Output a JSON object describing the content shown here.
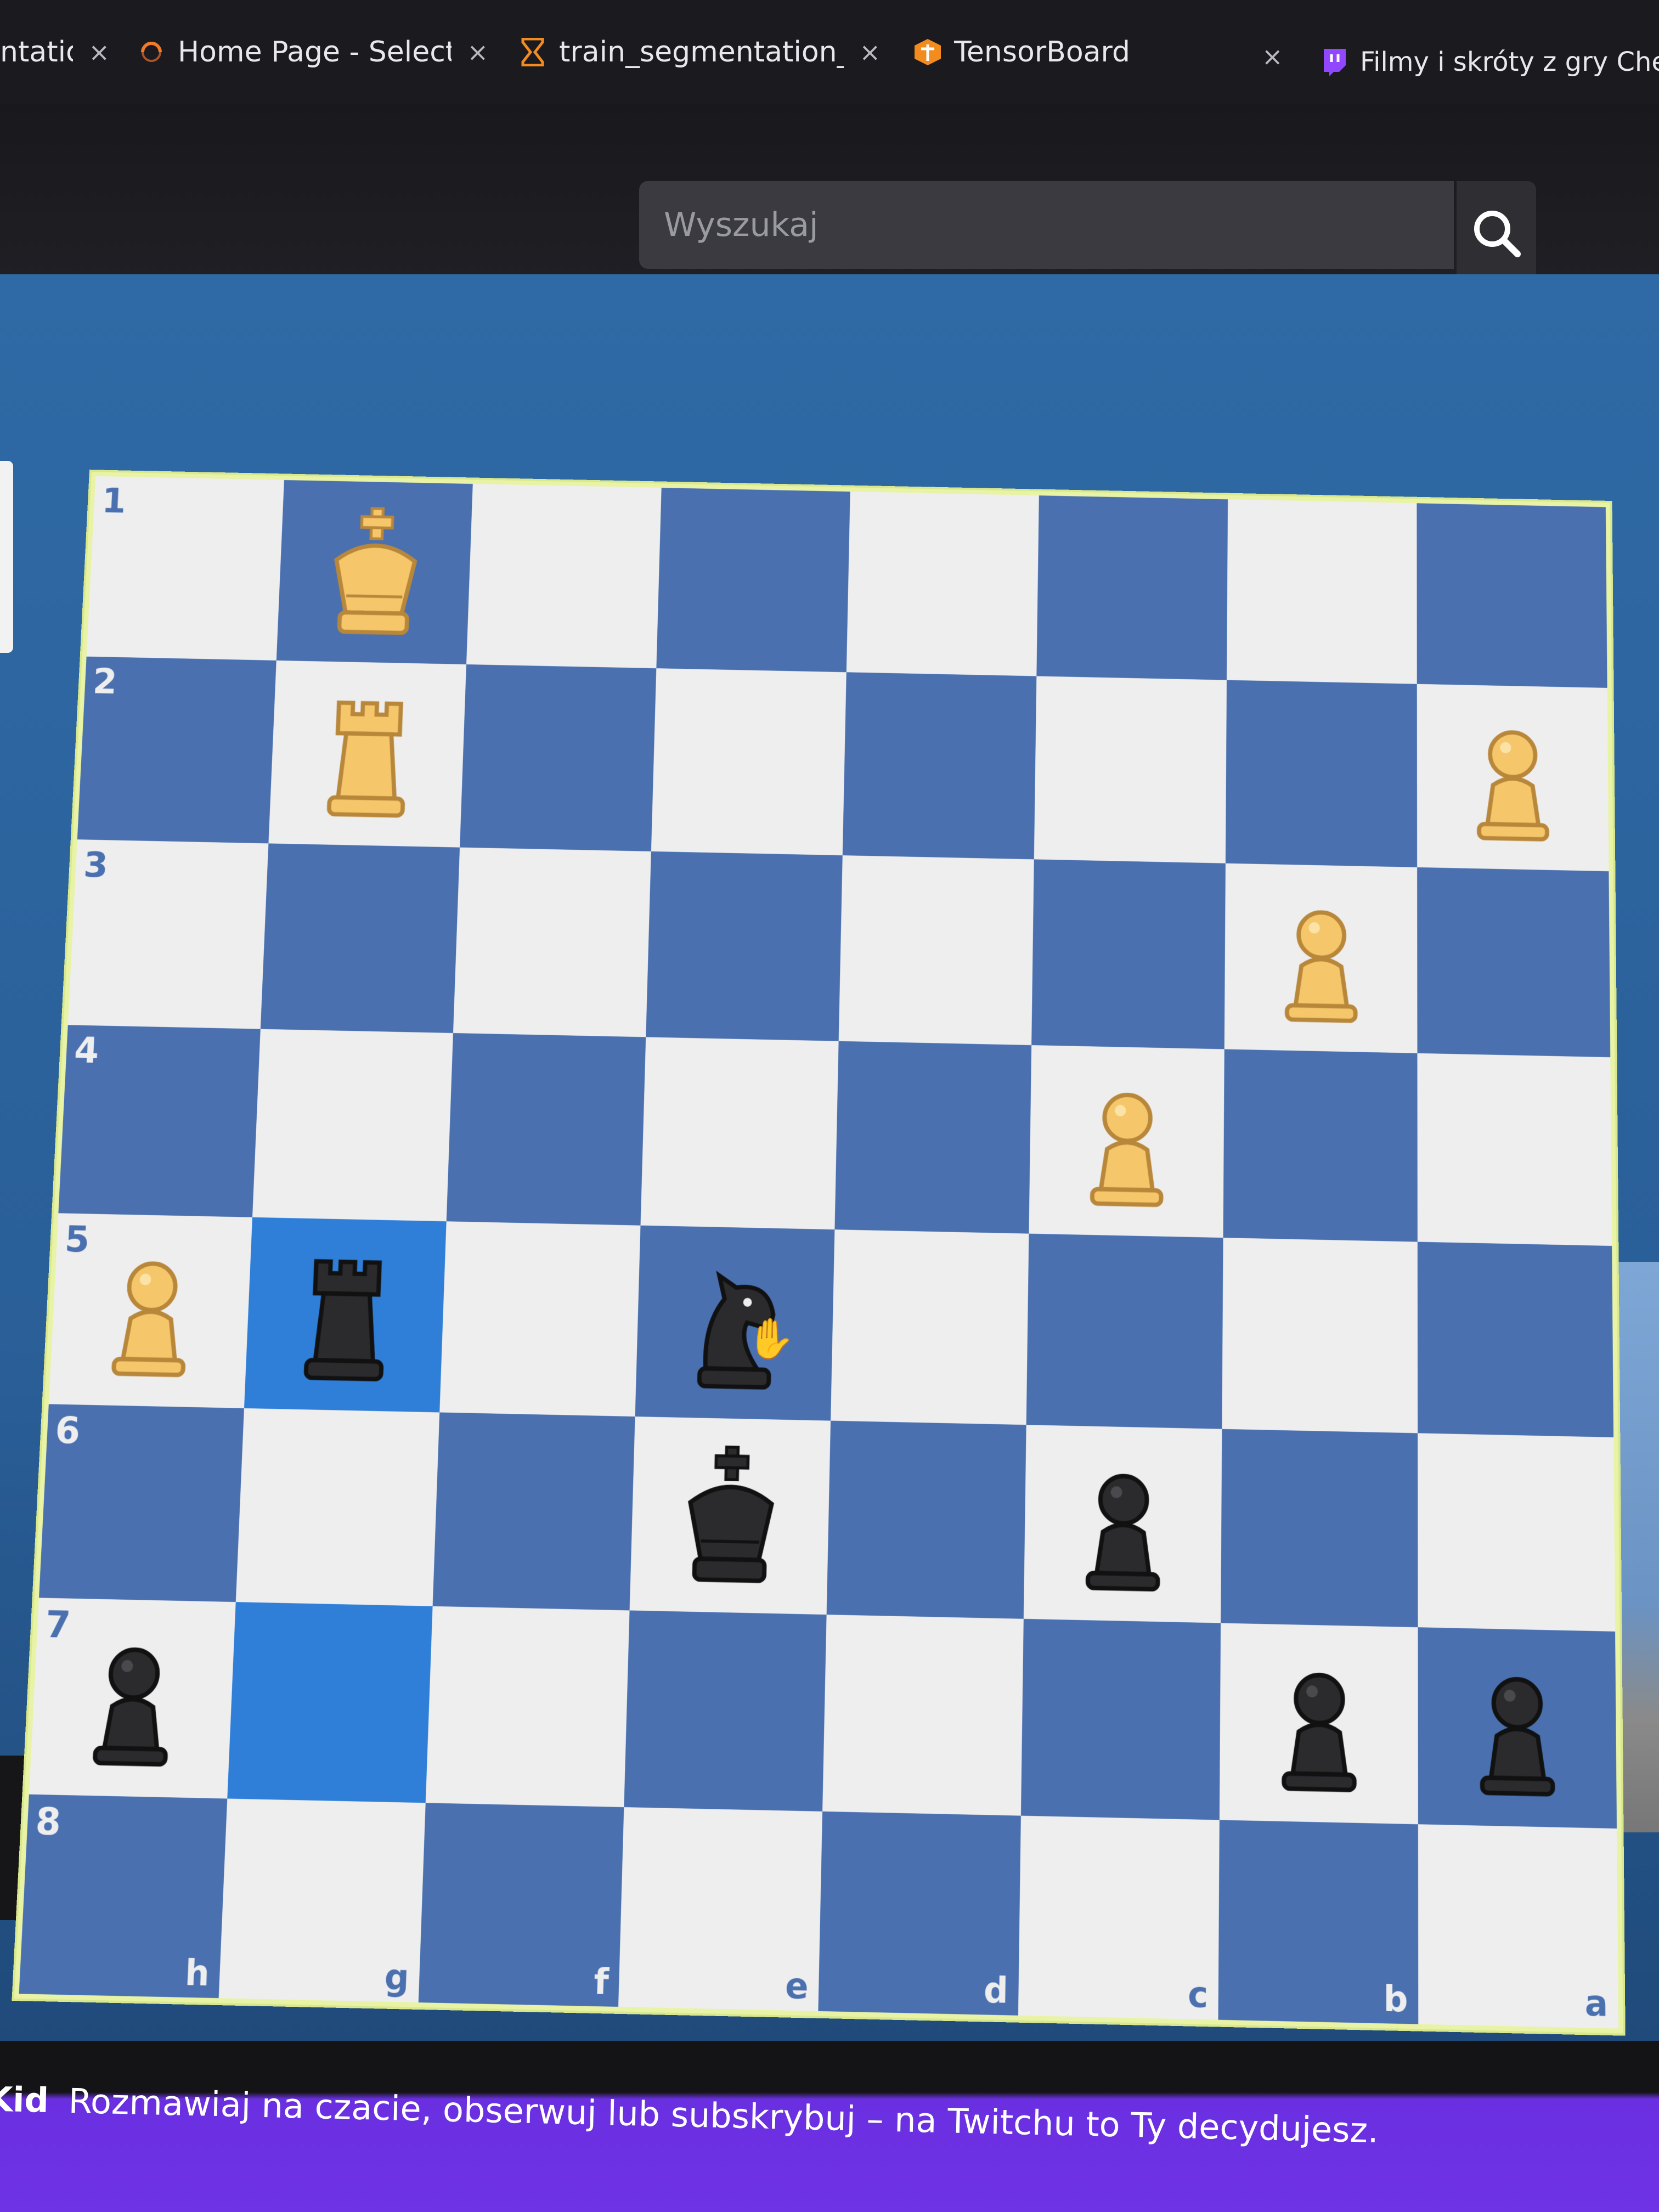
{
  "browser": {
    "tabs": [
      {
        "title": "ntatio",
        "icon": "document-icon"
      },
      {
        "title": "Home Page - Select or cr",
        "icon": "loading-icon"
      },
      {
        "title": "train_segmentation_mo",
        "icon": "hourglass-icon"
      },
      {
        "title": "TensorBoard",
        "icon": "tensorboard-icon"
      },
      {
        "title": "Filmy i skróty z gry Ches",
        "icon": "twitch-icon"
      }
    ],
    "close_glyph": "×"
  },
  "header": {
    "search_placeholder": "Wyszukaj",
    "search_icon": "search-icon"
  },
  "board": {
    "orientation": "black-bottom",
    "ranks": [
      "1",
      "2",
      "3",
      "4",
      "5",
      "6",
      "7",
      "8"
    ],
    "files": [
      "h",
      "g",
      "f",
      "e",
      "d",
      "c",
      "b",
      "a"
    ],
    "highlighted": [
      "g5",
      "g7"
    ],
    "cursor": "hand-cursor-icon",
    "colors": {
      "light": "#eeeeee",
      "dark": "#4a70b0",
      "highlight": "#2f7fd8",
      "white_piece": "#f5c66a",
      "black_piece": "#2b2b2e"
    },
    "pieces": [
      {
        "square": "g1",
        "color": "white",
        "type": "king"
      },
      {
        "square": "g2",
        "color": "white",
        "type": "rook"
      },
      {
        "square": "a2",
        "color": "white",
        "type": "pawn"
      },
      {
        "square": "b3",
        "color": "white",
        "type": "pawn"
      },
      {
        "square": "c4",
        "color": "white",
        "type": "pawn"
      },
      {
        "square": "h5",
        "color": "white",
        "type": "pawn"
      },
      {
        "square": "g5",
        "color": "black",
        "type": "rook"
      },
      {
        "square": "e5",
        "color": "black",
        "type": "knight"
      },
      {
        "square": "e6",
        "color": "black",
        "type": "king"
      },
      {
        "square": "c6",
        "color": "black",
        "type": "pawn"
      },
      {
        "square": "h7",
        "color": "black",
        "type": "pawn"
      },
      {
        "square": "b7",
        "color": "black",
        "type": "pawn"
      },
      {
        "square": "a7",
        "color": "black",
        "type": "pawn"
      }
    ]
  },
  "twitch_banner": {
    "prefix": "Kid",
    "text": "Rozmawiaj na czacie, obserwuj lub subskrybuj – na Twitchu to Ty decydujesz."
  }
}
